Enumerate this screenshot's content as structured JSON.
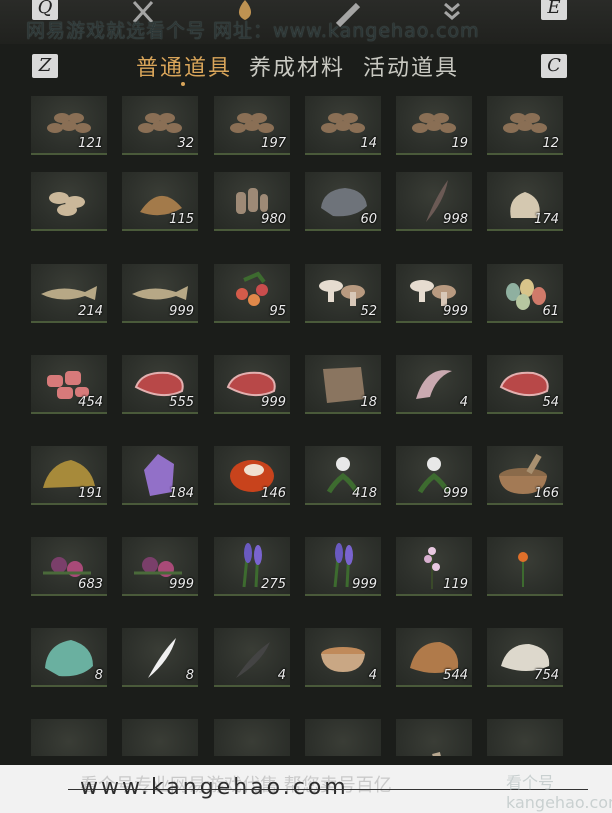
{
  "hotkeys": {
    "prev_category": "Q",
    "next_category": "E",
    "prev_tab": "Z",
    "next_tab": "C"
  },
  "watermark_top": "网易游戏就选看个号 网址：www.kangehao.com",
  "tabs": [
    {
      "label": "普通道具",
      "active": true
    },
    {
      "label": "养成材料",
      "active": false
    },
    {
      "label": "活动道具",
      "active": false
    }
  ],
  "items": [
    {
      "icon": "log-pile-icon",
      "count": "121"
    },
    {
      "icon": "log-pile-icon",
      "count": "32"
    },
    {
      "icon": "log-pile-icon",
      "count": "197"
    },
    {
      "icon": "log-pile-icon",
      "count": "14"
    },
    {
      "icon": "log-pile-icon",
      "count": "19"
    },
    {
      "icon": "log-pile-icon",
      "count": "12"
    },
    {
      "icon": "log-bundle-icon",
      "count": ""
    },
    {
      "icon": "bark-fiber-icon",
      "count": "115"
    },
    {
      "icon": "wood-pieces-icon",
      "count": "980"
    },
    {
      "icon": "stone-icon",
      "count": "60"
    },
    {
      "icon": "feather-icon",
      "count": "998"
    },
    {
      "icon": "grain-sack-icon",
      "count": "174"
    },
    {
      "icon": "fish-icon",
      "count": "214"
    },
    {
      "icon": "fish-icon",
      "count": "999"
    },
    {
      "icon": "berries-icon",
      "count": "95"
    },
    {
      "icon": "mushroom-icon",
      "count": "52"
    },
    {
      "icon": "mushroom-icon",
      "count": "999"
    },
    {
      "icon": "eggs-icon",
      "count": "61"
    },
    {
      "icon": "raw-meat-chunks-icon",
      "count": "454"
    },
    {
      "icon": "steak-icon",
      "count": "555"
    },
    {
      "icon": "steak-icon",
      "count": "999"
    },
    {
      "icon": "hide-icon",
      "count": "18"
    },
    {
      "icon": "intestine-icon",
      "count": "4"
    },
    {
      "icon": "steak-icon",
      "count": "54"
    },
    {
      "icon": "gold-ore-icon",
      "count": "191"
    },
    {
      "icon": "amethyst-icon",
      "count": "184"
    },
    {
      "icon": "amber-icon",
      "count": "146"
    },
    {
      "icon": "white-flower-herb-icon",
      "count": "418"
    },
    {
      "icon": "white-flower-herb-icon",
      "count": "999"
    },
    {
      "icon": "mortar-bowl-icon",
      "count": "166"
    },
    {
      "icon": "purple-flower-icon",
      "count": "683"
    },
    {
      "icon": "purple-flower-icon",
      "count": "999"
    },
    {
      "icon": "lavender-icon",
      "count": "275"
    },
    {
      "icon": "lavender-icon",
      "count": "999"
    },
    {
      "icon": "pink-blossom-icon",
      "count": "119"
    },
    {
      "icon": "orange-flower-icon",
      "count": ""
    },
    {
      "icon": "jade-stone-icon",
      "count": "8"
    },
    {
      "icon": "white-feather-icon",
      "count": "8"
    },
    {
      "icon": "dark-feather-icon",
      "count": "4"
    },
    {
      "icon": "bowl-icon",
      "count": "4"
    },
    {
      "icon": "fur-pelt-icon",
      "count": "544"
    },
    {
      "icon": "white-fur-icon",
      "count": "754"
    },
    {
      "icon": "ore-icon",
      "count": ""
    },
    {
      "icon": "iron-ore-icon",
      "count": ""
    },
    {
      "icon": "iron-ore-icon",
      "count": ""
    },
    {
      "icon": "blue-crystal-icon",
      "count": ""
    },
    {
      "icon": "bone-icon",
      "count": ""
    },
    {
      "icon": "melon-icon",
      "count": ""
    }
  ],
  "banner": {
    "text_cn": "看个号专业网易游戏代售 帮您卖号百亿",
    "url": "www.kangehao.com",
    "logo": "看个号 kangehao.com"
  }
}
